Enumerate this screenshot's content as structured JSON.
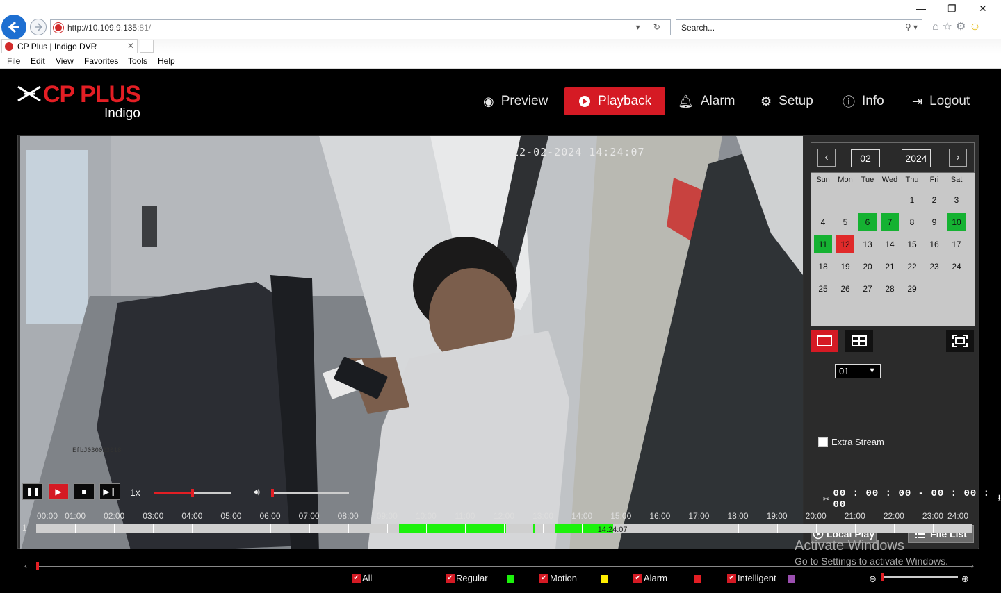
{
  "browser": {
    "url_host": "http://10.109.9.135",
    "url_port": ":81/",
    "search_placeholder": "Search...",
    "tab_title": "CP Plus | Indigo DVR",
    "menu": [
      "File",
      "Edit",
      "View",
      "Favorites",
      "Tools",
      "Help"
    ]
  },
  "app": {
    "brand": "CP PLUS",
    "sub": "Indigo",
    "nav": [
      {
        "label": "Preview",
        "icon": "eye-icon"
      },
      {
        "label": "Playback",
        "icon": "play-circle-icon",
        "active": true
      },
      {
        "label": "Alarm",
        "icon": "bell-icon"
      },
      {
        "label": "Setup",
        "icon": "gear-icon"
      },
      {
        "label": "Info",
        "icon": "info-icon"
      },
      {
        "label": "Logout",
        "icon": "logout-icon"
      }
    ]
  },
  "video": {
    "timestamp": "12-02-2024 14:24:07",
    "camera_id": "EfbJ030023018"
  },
  "calendar": {
    "month": "02",
    "year": "2024",
    "weekdays": [
      "Sun",
      "Mon",
      "Tue",
      "Wed",
      "Thu",
      "Fri",
      "Sat"
    ],
    "first_weekday_index": 4,
    "days_in_month": 29,
    "recorded_days": [
      6,
      7,
      10,
      11
    ],
    "selected_day": 12
  },
  "side": {
    "channel": "01",
    "extra_stream_label": "Extra Stream",
    "extra_stream_checked": false,
    "local_play_label": "Local Play",
    "file_list_label": "File List"
  },
  "controls": {
    "speed": "1x",
    "progress_fraction": 0.5,
    "volume_fraction": 0.0,
    "clip_time": "00 : 00 : 00 - 00 : 00 : 00"
  },
  "timeline": {
    "hours": [
      "00:00",
      "01:00",
      "02:00",
      "03:00",
      "04:00",
      "05:00",
      "06:00",
      "07:00",
      "08:00",
      "09:00",
      "10:00",
      "11:00",
      "12:00",
      "13:00",
      "14:00",
      "15:00",
      "16:00",
      "17:00",
      "18:00",
      "19:00",
      "20:00",
      "21:00",
      "22:00",
      "23:00",
      "24:00"
    ],
    "channel_no": "1",
    "recordings": [
      {
        "start": 9.3,
        "end": 12.05
      },
      {
        "start": 12.75,
        "end": 12.78
      },
      {
        "start": 13.3,
        "end": 14.8
      }
    ],
    "cursor_label": "14:24:07"
  },
  "legend": [
    {
      "label": "All",
      "color": ""
    },
    {
      "label": "Regular",
      "color": "#1cf20c"
    },
    {
      "label": "Motion",
      "color": "#ffee00"
    },
    {
      "label": "Alarm",
      "color": "#e31e24"
    },
    {
      "label": "Intelligent",
      "color": "#9b4fb0"
    }
  ],
  "watermark": {
    "line1": "Activate Windows",
    "line2": "Go to Settings to activate Windows."
  }
}
